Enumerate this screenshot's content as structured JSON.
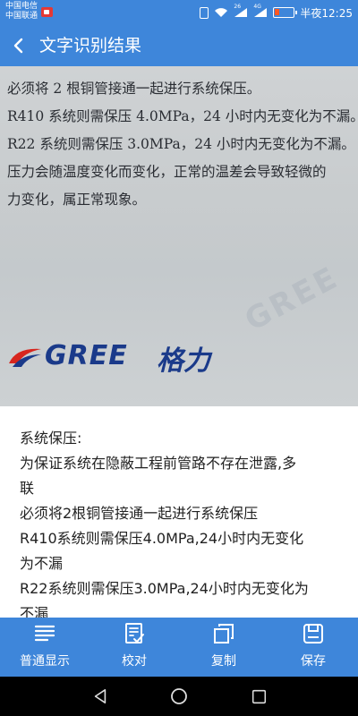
{
  "status_bar": {
    "carrier_1": "中国电信",
    "carrier_2": "中国联通",
    "signal_label_1": "26",
    "signal_label_2": "4G",
    "time": "半夜12:25"
  },
  "header": {
    "title": "文字识别结果"
  },
  "photo": {
    "lines": [
      "必须将 2 根铜管接通一起进行系统保压。",
      "R410 系统则需保压 4.0MPa，24 小时内无变化为不漏。",
      "R22 系统则需保压 3.0MPa，24 小时内无变化为不漏。",
      "压力会随温度变化而变化，正常的温差会导致轻微的",
      "力变化，属正常现象。"
    ],
    "watermark": "GREE",
    "logo_text": "GREE",
    "logo_script": "格力"
  },
  "result": {
    "lines": [
      "系统保压:",
      "为保证系统在隐蔽工程前管路不存在泄露,多",
      "联",
      "必须将2根铜管接通一起进行系统保压",
      "R410系统则需保压4.0MPa,24小时内无变化",
      "为不漏",
      "R22系统则需保压3.0MPa,24小时内无变化为",
      "不漏"
    ]
  },
  "toolbar": {
    "items": [
      {
        "label": "普通显示",
        "icon": "list-icon"
      },
      {
        "label": "校对",
        "icon": "proofread-icon"
      },
      {
        "label": "复制",
        "icon": "copy-icon"
      },
      {
        "label": "保存",
        "icon": "save-icon"
      }
    ]
  },
  "colors": {
    "accent": "#3e86da",
    "panel": "#ffffff",
    "text": "#222222"
  }
}
